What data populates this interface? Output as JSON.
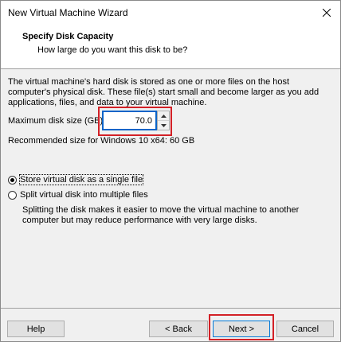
{
  "window": {
    "title": "New Virtual Machine Wizard"
  },
  "header": {
    "title": "Specify Disk Capacity",
    "subtitle": "How large do you want this disk to be?"
  },
  "content": {
    "description": "The virtual machine's hard disk is stored as one or more files on the host computer's physical disk. These file(s) start small and become larger as you add applications, files, and data to your virtual machine.",
    "max_disk_label": "Maximum disk size (GB):",
    "max_disk_value": "70.0",
    "recommended": "Recommended size for Windows 10 x64: 60 GB",
    "options": [
      {
        "label": "Store virtual disk as a single file",
        "selected": true
      },
      {
        "label": "Split virtual disk into multiple files",
        "selected": false
      }
    ],
    "split_note": "Splitting the disk makes it easier to move the virtual machine to another computer but may reduce performance with very large disks."
  },
  "footer": {
    "help": "Help",
    "back": "< Back",
    "next": "Next >",
    "cancel": "Cancel"
  },
  "icons": {
    "close": "close-icon",
    "spin_up": "chevron-up-icon",
    "spin_down": "chevron-down-icon"
  },
  "colors": {
    "highlight": "#d32026",
    "focus": "#0a64c8"
  }
}
